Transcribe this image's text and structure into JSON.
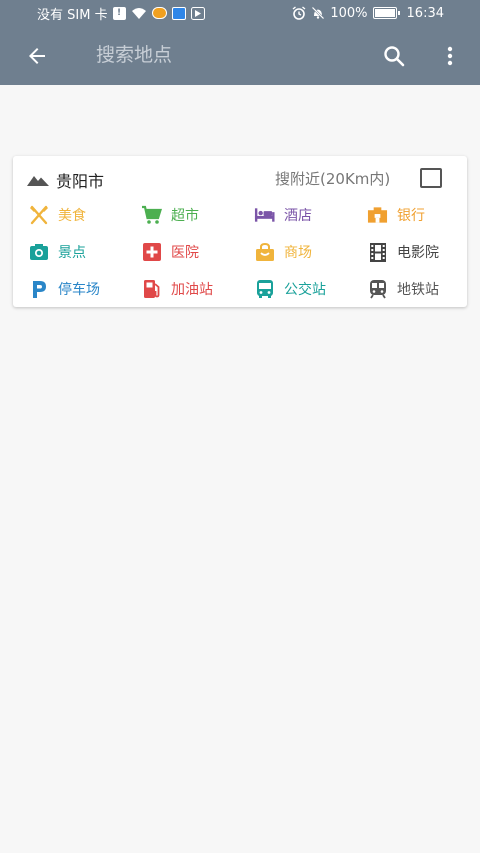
{
  "status_bar": {
    "carrier": "没有 SIM 卡",
    "battery_percent": "100%",
    "time": "16:34"
  },
  "app_bar": {
    "search_placeholder": "搜索地点"
  },
  "card": {
    "city": "贵阳市",
    "nearby_label": "搜附近(20Km内)",
    "nearby_checked": false,
    "categories": [
      {
        "label": "美食",
        "icon": "food-icon",
        "color": "#f0b43c"
      },
      {
        "label": "超市",
        "icon": "cart-icon",
        "color": "#4caf50"
      },
      {
        "label": "酒店",
        "icon": "hotel-icon",
        "color": "#7b55a8"
      },
      {
        "label": "银行",
        "icon": "bank-icon",
        "color": "#f0a030"
      },
      {
        "label": "景点",
        "icon": "camera-icon",
        "color": "#1aa19a"
      },
      {
        "label": "医院",
        "icon": "hospital-icon",
        "color": "#e04848"
      },
      {
        "label": "商场",
        "icon": "shopping-bag-icon",
        "color": "#f0b43c"
      },
      {
        "label": "电影院",
        "icon": "film-icon",
        "color": "#444444"
      },
      {
        "label": "停车场",
        "icon": "parking-icon",
        "color": "#2a86c8"
      },
      {
        "label": "加油站",
        "icon": "gas-station-icon",
        "color": "#e04848"
      },
      {
        "label": "公交站",
        "icon": "bus-icon",
        "color": "#1aa19a"
      },
      {
        "label": "地铁站",
        "icon": "subway-icon",
        "color": "#555555"
      }
    ]
  }
}
